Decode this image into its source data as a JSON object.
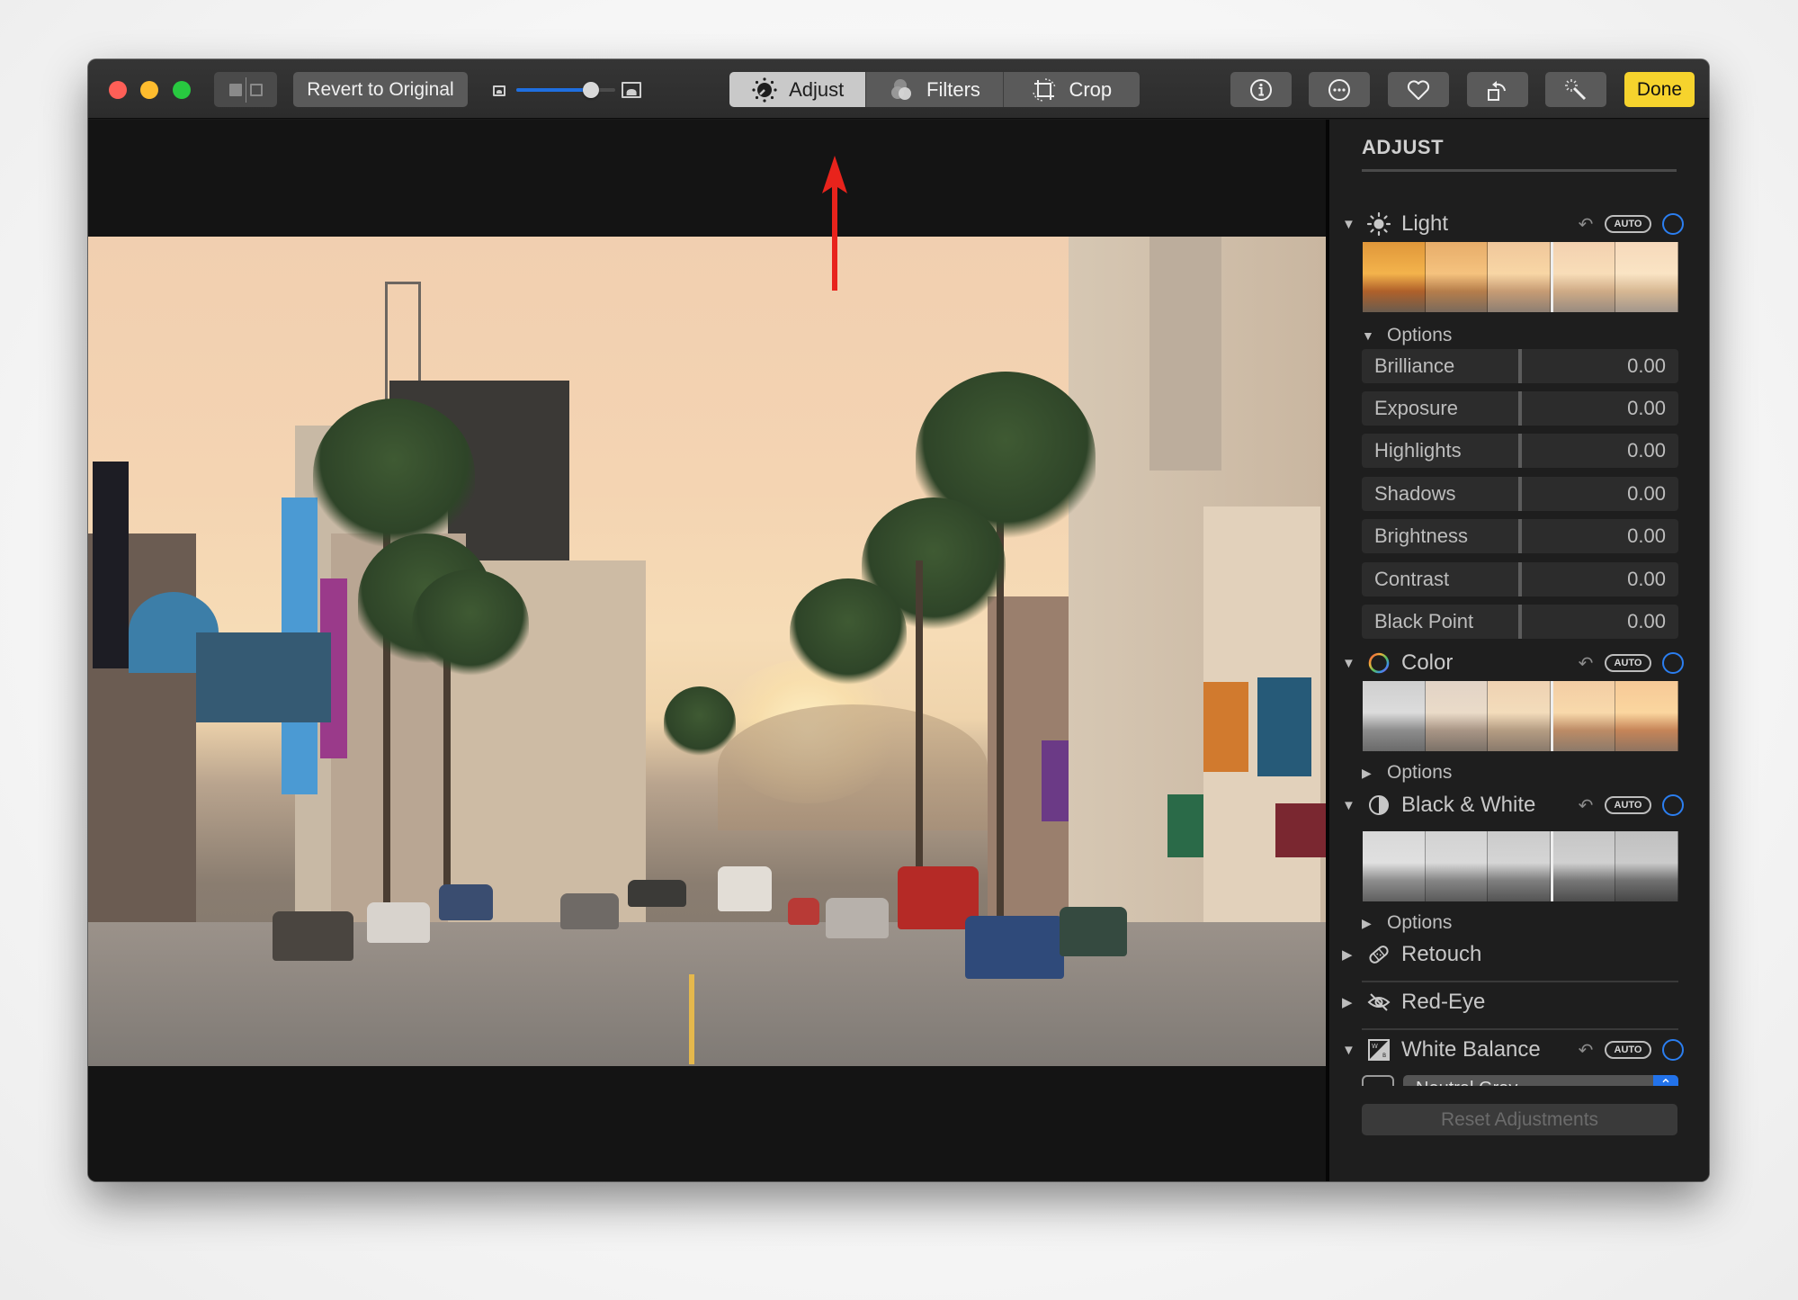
{
  "toolbar": {
    "window_controls": [
      "close",
      "minimize",
      "zoom"
    ],
    "split_view_icon": "split-view-icon",
    "revert_label": "Revert to Original",
    "zoom_slider": {
      "value_fraction": 0.75,
      "min_icon": "small-photo-icon",
      "max_icon": "large-photo-icon"
    },
    "tabs": [
      {
        "label": "Adjust",
        "icon": "adjust-dial-icon",
        "active": true
      },
      {
        "label": "Filters",
        "icon": "filters-circles-icon",
        "active": false
      },
      {
        "label": "Crop",
        "icon": "crop-rotate-icon",
        "active": false
      }
    ],
    "right_buttons": [
      {
        "name": "info",
        "icon": "info-icon"
      },
      {
        "name": "more",
        "icon": "ellipsis-circle-icon"
      },
      {
        "name": "favorite",
        "icon": "heart-icon"
      },
      {
        "name": "rotate",
        "icon": "rotate-icon"
      },
      {
        "name": "enhance",
        "icon": "magic-wand-icon"
      }
    ],
    "done_label": "Done"
  },
  "annotation": {
    "type": "arrow",
    "color": "#e8231c",
    "points_to": "Adjust"
  },
  "panel": {
    "title": "ADJUST",
    "sections": {
      "light": {
        "label": "Light",
        "icon": "sun-icon",
        "auto_label": "AUTO",
        "expanded": true
      },
      "light_options": {
        "label": "Options",
        "expanded": true,
        "sliders": [
          {
            "label": "Brilliance",
            "value": "0.00"
          },
          {
            "label": "Exposure",
            "value": "0.00"
          },
          {
            "label": "Highlights",
            "value": "0.00"
          },
          {
            "label": "Shadows",
            "value": "0.00"
          },
          {
            "label": "Brightness",
            "value": "0.00"
          },
          {
            "label": "Contrast",
            "value": "0.00"
          },
          {
            "label": "Black Point",
            "value": "0.00"
          }
        ]
      },
      "color": {
        "label": "Color",
        "icon": "color-ring-icon",
        "auto_label": "AUTO",
        "expanded": true,
        "options_label": "Options"
      },
      "bw": {
        "label": "Black & White",
        "icon": "half-circle-icon",
        "auto_label": "AUTO",
        "expanded": true,
        "options_label": "Options"
      },
      "retouch": {
        "label": "Retouch",
        "icon": "bandage-icon",
        "expanded": false
      },
      "redeye": {
        "label": "Red-Eye",
        "icon": "red-eye-icon",
        "expanded": false
      },
      "white_balance": {
        "label": "White Balance",
        "icon": "white-balance-icon",
        "auto_label": "AUTO",
        "expanded": true,
        "select_value": "Neutral Gray"
      }
    },
    "reset_label": "Reset Adjustments"
  },
  "colors": {
    "accent_blue": "#2b7ef0",
    "done_yellow": "#f6d32d",
    "annotation_red": "#e8231c"
  }
}
